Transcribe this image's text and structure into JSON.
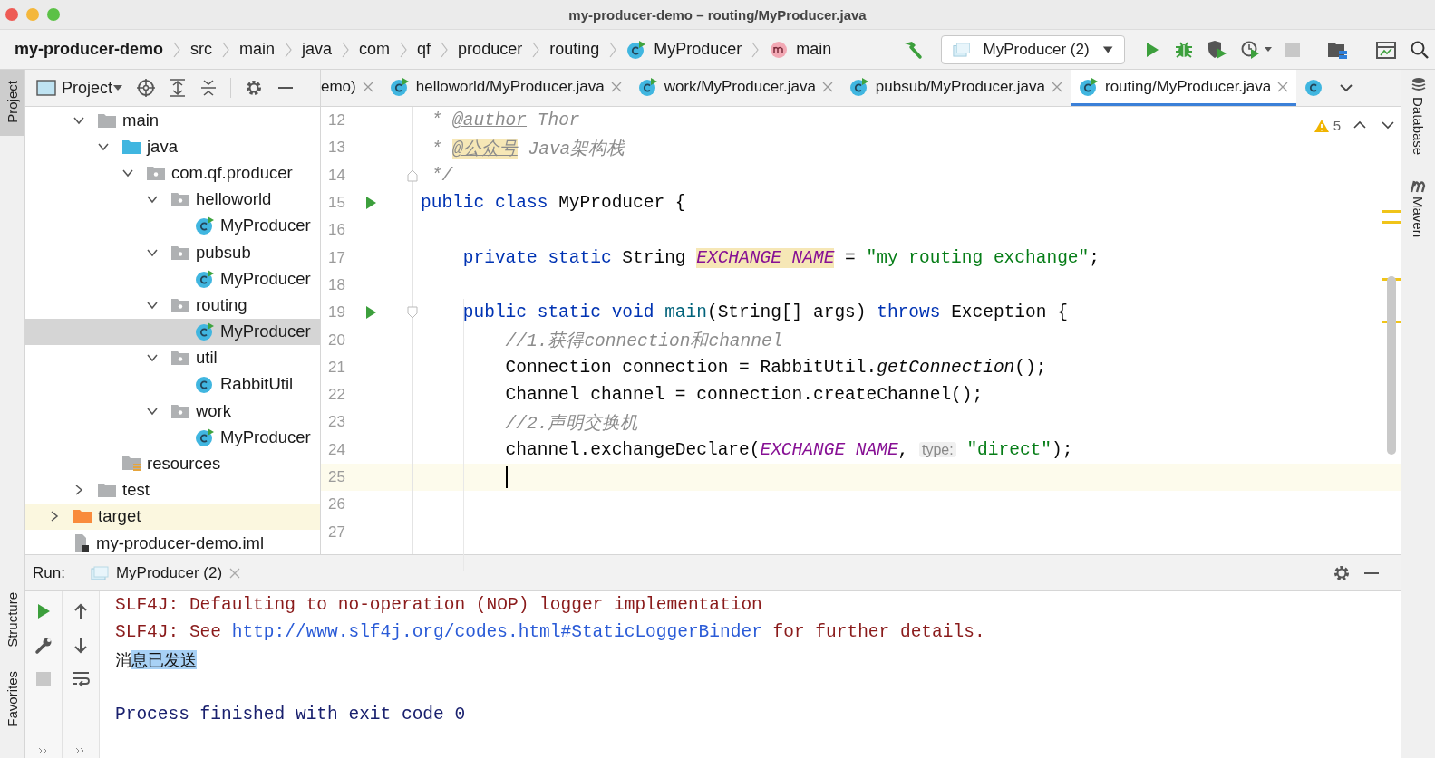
{
  "window": {
    "title": "my-producer-demo – routing/MyProducer.java"
  },
  "breadcrumbs": [
    {
      "label": "my-producer-demo",
      "kind": "module"
    },
    {
      "label": "src",
      "kind": "folder"
    },
    {
      "label": "main",
      "kind": "folder"
    },
    {
      "label": "java",
      "kind": "folder"
    },
    {
      "label": "com",
      "kind": "folder"
    },
    {
      "label": "qf",
      "kind": "folder"
    },
    {
      "label": "producer",
      "kind": "folder"
    },
    {
      "label": "routing",
      "kind": "folder"
    },
    {
      "label": "MyProducer",
      "kind": "class"
    },
    {
      "label": "main",
      "kind": "method"
    }
  ],
  "run_config": {
    "label": "MyProducer (2)"
  },
  "toolbar": [
    {
      "kind": "run",
      "disabled": false
    },
    {
      "kind": "debug",
      "disabled": false
    },
    {
      "kind": "coverage",
      "disabled": false
    },
    {
      "kind": "profile",
      "disabled": false
    },
    {
      "kind": "stop",
      "disabled": true
    }
  ],
  "left_tools": [
    {
      "label": "Project",
      "selected": true
    },
    {
      "label": "Structure",
      "selected": false
    },
    {
      "label": "Favorites",
      "selected": false
    }
  ],
  "right_tools": [
    {
      "label": "Database"
    },
    {
      "label": "Maven"
    }
  ],
  "project_panel": {
    "title": "Project",
    "tree": [
      {
        "children": [
          {
            "label": "main",
            "kind": "folder",
            "expanded": true,
            "selected": false,
            "children": [
              {
                "label": "java",
                "kind": "source",
                "expanded": true,
                "selected": false,
                "children": [
                  {
                    "label": "com.qf.producer",
                    "kind": "package",
                    "expanded": true,
                    "selected": false,
                    "children": [
                      {
                        "label": "helloworld",
                        "kind": "package",
                        "expanded": true,
                        "selected": false,
                        "children": [
                          {
                            "label": "MyProducer",
                            "kind": "main_class",
                            "selected": false
                          }
                        ]
                      },
                      {
                        "label": "pubsub",
                        "kind": "package",
                        "expanded": true,
                        "selected": false,
                        "children": [
                          {
                            "label": "MyProducer",
                            "kind": "main_class",
                            "selected": false
                          }
                        ]
                      },
                      {
                        "label": "routing",
                        "kind": "package",
                        "expanded": true,
                        "selected": false,
                        "children": [
                          {
                            "label": "MyProducer",
                            "kind": "main_class",
                            "selected": true
                          }
                        ]
                      },
                      {
                        "label": "util",
                        "kind": "package",
                        "expanded": true,
                        "selected": false,
                        "children": [
                          {
                            "label": "RabbitUtil",
                            "kind": "class",
                            "selected": false
                          }
                        ]
                      },
                      {
                        "label": "work",
                        "kind": "package",
                        "expanded": true,
                        "selected": false,
                        "children": [
                          {
                            "label": "MyProducer",
                            "kind": "main_class",
                            "selected": false
                          }
                        ]
                      }
                    ]
                  }
                ]
              },
              {
                "label": "resources",
                "kind": "resources",
                "selected": false
              }
            ]
          },
          {
            "label": "test",
            "kind": "folder",
            "expanded": false,
            "selected": false
          }
        ]
      },
      {
        "label": "target",
        "kind": "excluded",
        "expanded": false,
        "selected": false
      },
      {
        "label": "my-producer-demo.iml",
        "kind": "iml",
        "selected": false
      }
    ]
  },
  "editor_tabs": [
    {
      "label": "emo)",
      "selected": false
    },
    {
      "label": "helloworld/MyProducer.java",
      "selected": false
    },
    {
      "label": "work/MyProducer.java",
      "selected": false
    },
    {
      "label": "pubsub/MyProducer.java",
      "selected": false
    },
    {
      "label": "routing/MyProducer.java",
      "selected": true
    }
  ],
  "inspections": {
    "warnings": "5"
  },
  "code_lines": [
    {
      "number": "12",
      "current": false,
      "run_marker": false,
      "caret": false,
      "tokens": [
        {
          "text": " * ",
          "kind": "comment"
        },
        {
          "text": "@author",
          "kind": "doc_tag"
        },
        {
          "text": " Thor",
          "kind": "comment"
        }
      ]
    },
    {
      "number": "13",
      "current": false,
      "run_marker": false,
      "caret": false,
      "tokens": [
        {
          "text": " * ",
          "kind": "comment"
        },
        {
          "text": "@公众号",
          "kind": "doc_tag_hl"
        },
        {
          "text": " Java架构栈",
          "kind": "comment"
        }
      ]
    },
    {
      "number": "14",
      "current": false,
      "run_marker": false,
      "caret": false,
      "fold": {
        "kind": "end"
      },
      "tokens": [
        {
          "text": " */",
          "kind": "comment"
        }
      ]
    },
    {
      "number": "15",
      "current": false,
      "run_marker": true,
      "caret": false,
      "tokens": [
        {
          "text": "public class ",
          "kind": "keyword"
        },
        {
          "text": "MyProducer {",
          "kind": "plain"
        }
      ]
    },
    {
      "number": "16",
      "current": false,
      "run_marker": false,
      "caret": false
    },
    {
      "number": "17",
      "current": false,
      "run_marker": false,
      "caret": false,
      "tokens": [
        {
          "text": "    private static ",
          "kind": "keyword"
        },
        {
          "text": "String ",
          "kind": "plain"
        },
        {
          "text": "EXCHANGE_NAME",
          "kind": "const_hl"
        },
        {
          "text": " = ",
          "kind": "plain"
        },
        {
          "text": "\"my_routing_exchange\"",
          "kind": "string"
        },
        {
          "text": ";",
          "kind": "plain"
        }
      ]
    },
    {
      "number": "18",
      "current": false,
      "run_marker": false,
      "caret": false
    },
    {
      "number": "19",
      "current": false,
      "run_marker": true,
      "caret": false,
      "fold": {
        "kind": "start"
      },
      "tokens": [
        {
          "text": "    public static void ",
          "kind": "keyword"
        },
        {
          "text": "main",
          "kind": "method_decl"
        },
        {
          "text": "(String[] args) ",
          "kind": "plain"
        },
        {
          "text": "throws ",
          "kind": "keyword"
        },
        {
          "text": "Exception {",
          "kind": "plain"
        }
      ]
    },
    {
      "number": "20",
      "current": false,
      "run_marker": false,
      "caret": false,
      "tokens": [
        {
          "text": "        //1.获得connection和channel",
          "kind": "comment"
        }
      ]
    },
    {
      "number": "21",
      "current": false,
      "run_marker": false,
      "caret": false,
      "tokens": [
        {
          "text": "        Connection connection = RabbitUtil.",
          "kind": "plain"
        },
        {
          "text": "getConnection",
          "kind": "static_call"
        },
        {
          "text": "();",
          "kind": "plain"
        }
      ]
    },
    {
      "number": "22",
      "current": false,
      "run_marker": false,
      "caret": false,
      "tokens": [
        {
          "text": "        Channel channel = connection.createChannel();",
          "kind": "plain"
        }
      ]
    },
    {
      "number": "23",
      "current": false,
      "run_marker": false,
      "caret": false,
      "tokens": [
        {
          "text": "        //2.声明交换机",
          "kind": "comment"
        }
      ]
    },
    {
      "number": "24",
      "current": false,
      "run_marker": false,
      "caret": false,
      "tokens": [
        {
          "text": "        channel.exchangeDeclare(",
          "kind": "plain"
        },
        {
          "text": "EXCHANGE_NAME",
          "kind": "const"
        },
        {
          "text": ", ",
          "kind": "plain"
        },
        {
          "text": "type:",
          "kind": "hint"
        },
        {
          "text": " \"direct\"",
          "kind": "string"
        },
        {
          "text": ");",
          "kind": "plain"
        }
      ]
    },
    {
      "number": "25",
      "current": true,
      "run_marker": false,
      "caret": true
    },
    {
      "number": "26",
      "current": false,
      "run_marker": false,
      "caret": false
    },
    {
      "number": "27",
      "current": false,
      "run_marker": false,
      "caret": false
    }
  ],
  "run_panel": {
    "label": "Run:",
    "tab": "MyProducer (2)",
    "tools_left": [
      {
        "kind": "rerun",
        "disabled": false
      },
      {
        "kind": "wrench",
        "disabled": false
      },
      {
        "kind": "stop",
        "disabled": true
      }
    ],
    "tools_right": [
      {
        "kind": "up",
        "disabled": false
      },
      {
        "kind": "down",
        "disabled": false
      },
      {
        "kind": "wrap",
        "disabled": false
      }
    ],
    "output": [
      {
        "kind": "stderr",
        "spaced": false,
        "parts": [
          {
            "text": "SLF4J: Defaulting to no-operation (NOP) logger implementation",
            "kind": "text",
            "selected": false
          }
        ]
      },
      {
        "kind": "stderr",
        "spaced": false,
        "parts": [
          {
            "text": "SLF4J: See ",
            "kind": "text",
            "selected": false
          },
          {
            "text": "http://www.slf4j.org/codes.html#StaticLoggerBinder",
            "kind": "link",
            "selected": false
          },
          {
            "text": " for further details.",
            "kind": "text",
            "selected": false
          }
        ]
      },
      {
        "kind": "stdout",
        "spaced": false,
        "parts": [
          {
            "text": "消",
            "kind": "text",
            "selected": false
          },
          {
            "text": "息已发送",
            "kind": "text",
            "selected": true
          }
        ]
      },
      {
        "kind": "system",
        "spaced": true,
        "parts": [
          {
            "text": "Process finished with exit code 0",
            "kind": "text",
            "selected": false
          }
        ]
      }
    ]
  }
}
